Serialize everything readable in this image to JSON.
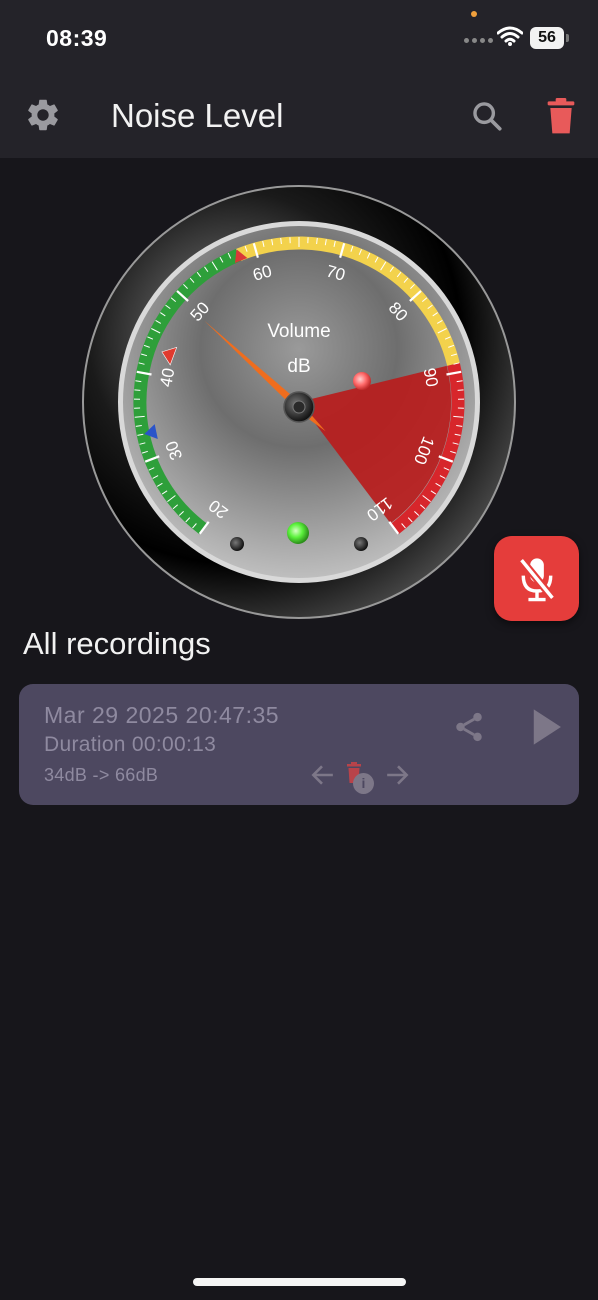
{
  "status_bar": {
    "time": "08:39",
    "battery": "56",
    "icons": [
      "signal-dots-icon",
      "wifi-icon",
      "battery-icon"
    ]
  },
  "app_bar": {
    "title": "Noise Level",
    "icons": {
      "left": "gear-icon",
      "right": [
        "search-icon",
        "trash-icon"
      ]
    },
    "colors": {
      "trash": "#e85a5a"
    }
  },
  "gauge": {
    "label_title": "Volume",
    "label_unit": "dB",
    "scale_min": 20,
    "scale_max": 110,
    "tick_labels": [
      "20",
      "30",
      "40",
      "50",
      "60",
      "70",
      "80",
      "90",
      "100",
      "110"
    ],
    "current_value": 50,
    "min_marker": 34,
    "max_marker": 66,
    "blue_marker": 33,
    "red_marker": 43,
    "zones": [
      {
        "from": 20,
        "to": 58,
        "color": "#2e9f3a"
      },
      {
        "from": 58,
        "to": 89,
        "color": "#f3d24c"
      },
      {
        "from": 89,
        "to": 110,
        "color": "#d7262b"
      }
    ],
    "red_sector": {
      "from": 89,
      "to": 110,
      "color": "#b91c1c"
    },
    "indicators": {
      "green_led": "#5cf23d",
      "red_led": "#ff6a6a"
    }
  },
  "mic_button": {
    "icon": "mic-off-icon",
    "color": "#e53d3b"
  },
  "recordings": {
    "title": "All recordings",
    "items": [
      {
        "date": "Mar 29 2025 20:47:35",
        "duration": "Duration 00:00:13",
        "range": "34dB -> 66dB",
        "icons": [
          "share-icon",
          "play-icon",
          "arrow-left-icon",
          "trash-icon",
          "info-icon",
          "arrow-right-icon"
        ]
      }
    ]
  }
}
